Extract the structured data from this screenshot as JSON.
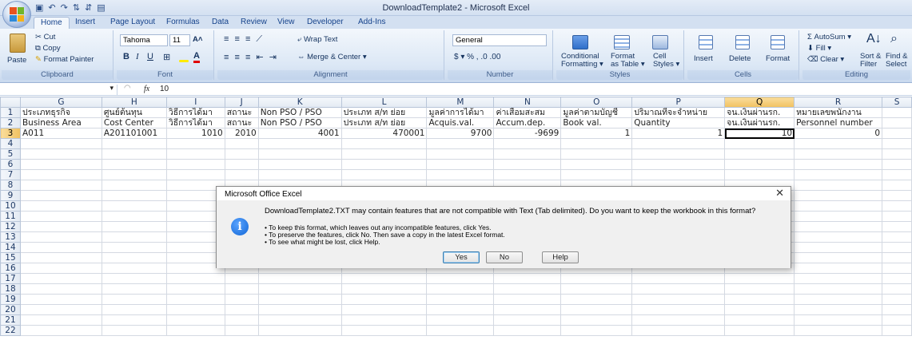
{
  "window": {
    "title": "DownloadTemplate2 - Microsoft Excel"
  },
  "tabs": [
    "Home",
    "Insert",
    "Page Layout",
    "Formulas",
    "Data",
    "Review",
    "View",
    "Developer",
    "Add-Ins"
  ],
  "ribbon": {
    "clipboard": {
      "label": "Clipboard",
      "paste": "Paste",
      "cut": "Cut",
      "copy": "Copy",
      "format_painter": "Format Painter"
    },
    "font": {
      "label": "Font",
      "name": "Tahoma",
      "size": "11"
    },
    "alignment": {
      "label": "Alignment",
      "wrap_text": "Wrap Text",
      "merge": "Merge & Center"
    },
    "number": {
      "label": "Number",
      "format": "General"
    },
    "styles": {
      "label": "Styles",
      "conditional": "Conditional",
      "formatting": "Formatting",
      "format": "Format",
      "as_table": "as Table",
      "cell": "Cell",
      "styles": "Styles"
    },
    "cells": {
      "label": "Cells",
      "insert": "Insert",
      "delete": "Delete",
      "format": "Format"
    },
    "editing": {
      "label": "Editing",
      "autosum": "AutoSum",
      "fill": "Fill",
      "clear": "Clear",
      "sort": "Sort &",
      "filter": "Filter",
      "find": "Find &",
      "select": "Select"
    }
  },
  "formula": {
    "fx": "fx",
    "value": "10"
  },
  "grid": {
    "columns": [
      "G",
      "H",
      "I",
      "J",
      "K",
      "L",
      "M",
      "N",
      "O",
      "P",
      "Q",
      "R",
      "S"
    ],
    "rows": [
      {
        "n": "1",
        "cells": [
          "ประเภทธุรกิจ",
          "ศูนย์ต้นทุน",
          "วิธีการได้มา",
          "สถานะ",
          "Non PSO / PSO",
          "ประเภท ส/ท ย่อย",
          "มูลค่าการได้มา",
          "ค่าเสื่อมสะสม",
          "มูลค่าตามบัญชี",
          "ปริมาณที่จะจำหน่าย",
          "จน.เงินผ่านรก.",
          "หมายเลขพนักงาน",
          ""
        ]
      },
      {
        "n": "2",
        "cells": [
          "Business Area",
          "Cost Center",
          "วิธีการได้มา",
          "สถานะ",
          "Non PSO / PSO",
          "ประเภท ส/ท ย่อย",
          "Acquis.val.",
          "Accum.dep.",
          "Book val.",
          "Quantity",
          "จน.เงินผ่านรก.",
          "Personnel number",
          ""
        ]
      },
      {
        "n": "3",
        "cells": [
          "A011",
          "A201101001",
          "1010",
          "2010",
          "4001",
          "470001",
          "9700",
          "-9699",
          "1",
          "1",
          "10",
          "0",
          ""
        ]
      },
      {
        "n": "4",
        "cells": [
          "",
          "",
          "",
          "",
          "",
          "",
          "",
          "",
          "",
          "",
          "",
          "",
          ""
        ]
      },
      {
        "n": "5",
        "cells": [
          "",
          "",
          "",
          "",
          "",
          "",
          "",
          "",
          "",
          "",
          "",
          "",
          ""
        ]
      },
      {
        "n": "6",
        "cells": [
          "",
          "",
          "",
          "",
          "",
          "",
          "",
          "",
          "",
          "",
          "",
          "",
          ""
        ]
      },
      {
        "n": "7",
        "cells": [
          "",
          "",
          "",
          "",
          "",
          "",
          "",
          "",
          "",
          "",
          "",
          "",
          ""
        ]
      },
      {
        "n": "8",
        "cells": [
          "",
          "",
          "",
          "",
          "",
          "",
          "",
          "",
          "",
          "",
          "",
          "",
          ""
        ]
      },
      {
        "n": "9",
        "cells": [
          "",
          "",
          "",
          "",
          "",
          "",
          "",
          "",
          "",
          "",
          "",
          "",
          ""
        ]
      },
      {
        "n": "10",
        "cells": [
          "",
          "",
          "",
          "",
          "",
          "",
          "",
          "",
          "",
          "",
          "",
          "",
          ""
        ]
      },
      {
        "n": "11",
        "cells": [
          "",
          "",
          "",
          "",
          "",
          "",
          "",
          "",
          "",
          "",
          "",
          "",
          ""
        ]
      },
      {
        "n": "12",
        "cells": [
          "",
          "",
          "",
          "",
          "",
          "",
          "",
          "",
          "",
          "",
          "",
          "",
          ""
        ]
      },
      {
        "n": "13",
        "cells": [
          "",
          "",
          "",
          "",
          "",
          "",
          "",
          "",
          "",
          "",
          "",
          "",
          ""
        ]
      },
      {
        "n": "14",
        "cells": [
          "",
          "",
          "",
          "",
          "",
          "",
          "",
          "",
          "",
          "",
          "",
          "",
          ""
        ]
      },
      {
        "n": "15",
        "cells": [
          "",
          "",
          "",
          "",
          "",
          "",
          "",
          "",
          "",
          "",
          "",
          "",
          ""
        ]
      },
      {
        "n": "16",
        "cells": [
          "",
          "",
          "",
          "",
          "",
          "",
          "",
          "",
          "",
          "",
          "",
          "",
          ""
        ]
      },
      {
        "n": "17",
        "cells": [
          "",
          "",
          "",
          "",
          "",
          "",
          "",
          "",
          "",
          "",
          "",
          "",
          ""
        ]
      },
      {
        "n": "18",
        "cells": [
          "",
          "",
          "",
          "",
          "",
          "",
          "",
          "",
          "",
          "",
          "",
          "",
          ""
        ]
      },
      {
        "n": "19",
        "cells": [
          "",
          "",
          "",
          "",
          "",
          "",
          "",
          "",
          "",
          "",
          "",
          "",
          ""
        ]
      },
      {
        "n": "20",
        "cells": [
          "",
          "",
          "",
          "",
          "",
          "",
          "",
          "",
          "",
          "",
          "",
          "",
          ""
        ]
      },
      {
        "n": "21",
        "cells": [
          "",
          "",
          "",
          "",
          "",
          "",
          "",
          "",
          "",
          "",
          "",
          "",
          ""
        ]
      },
      {
        "n": "22",
        "cells": [
          "",
          "",
          "",
          "",
          "",
          "",
          "",
          "",
          "",
          "",
          "",
          "",
          ""
        ]
      }
    ],
    "selected_column": "Q",
    "selected_row": "3"
  },
  "dialog": {
    "title": "Microsoft Office Excel",
    "message": "DownloadTemplate2.TXT may contain features that are not compatible with Text (Tab delimited).  Do you want to keep the workbook in this format?",
    "bullets": [
      "• To keep this format, which leaves out any incompatible features, click Yes.",
      "• To preserve the features, click No. Then save a copy in the latest Excel format.",
      "• To see what might be lost, click Help."
    ],
    "yes": "Yes",
    "no": "No",
    "help": "Help",
    "close": "✕"
  }
}
